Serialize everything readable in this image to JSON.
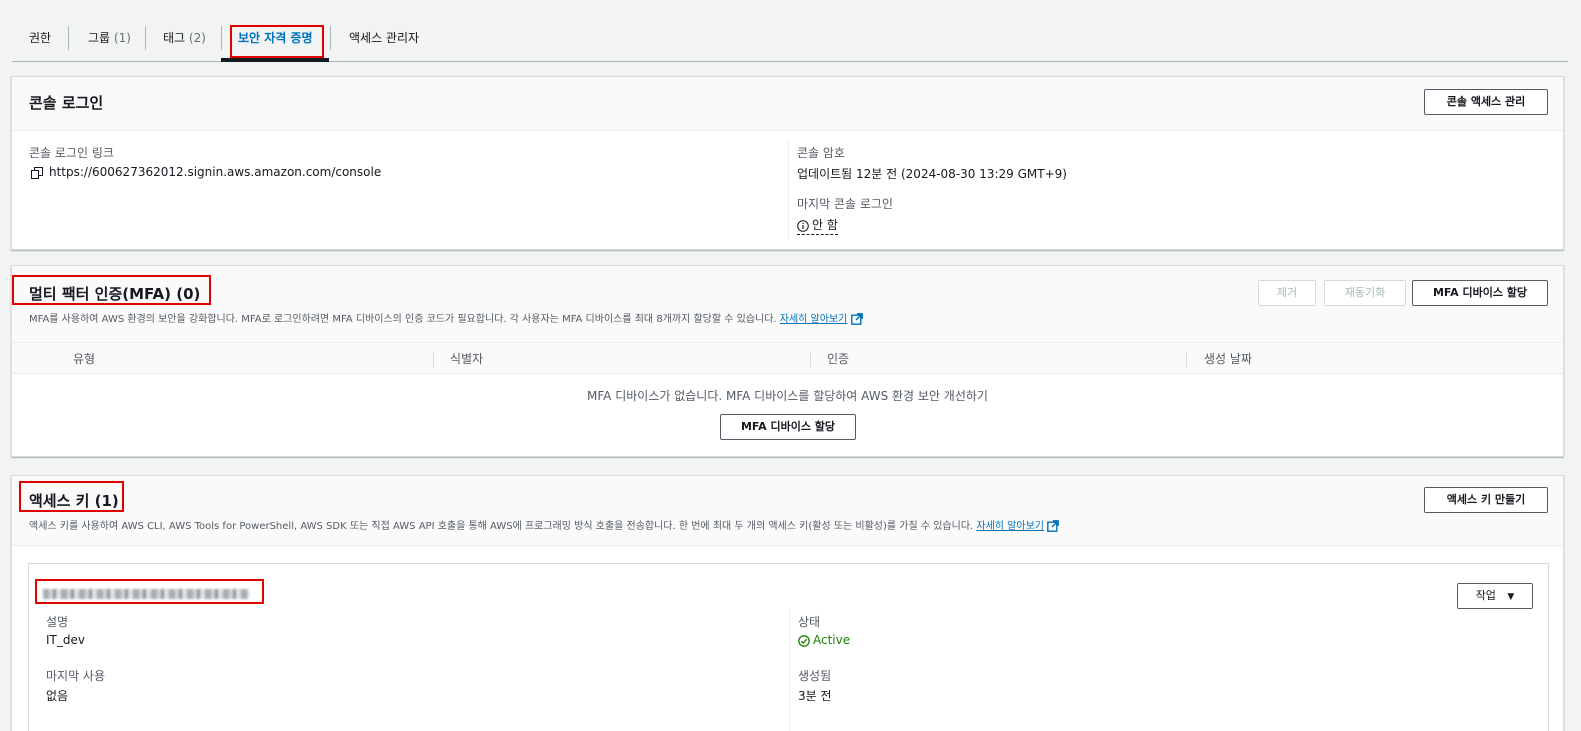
{
  "tabs": [
    {
      "label": "권한",
      "count": ""
    },
    {
      "label": "그룹",
      "count": "(1)"
    },
    {
      "label": "태그",
      "count": "(2)"
    },
    {
      "label": "보안 자격 증명",
      "count": ""
    },
    {
      "label": "액세스 관리자",
      "count": ""
    }
  ],
  "console": {
    "title": "콘솔 로그인",
    "manage_button": "콘솔 액세스 관리",
    "link_label": "콘솔 로그인 링크",
    "link_value": "https://600627362012.signin.aws.amazon.com/console",
    "password_label": "콘솔 암호",
    "password_value": "업데이트됨 12분 전 (2024-08-30 13:29 GMT+9)",
    "last_login_label": "마지막 콘솔 로그인",
    "last_login_value": "안 함"
  },
  "mfa": {
    "title": "멀티 팩터 인증(MFA) (0)",
    "description": "MFA를 사용하여 AWS 환경의 보안을 강화합니다. MFA로 로그인하려면 MFA 디바이스의 인증 코드가 필요합니다. 각 사용자는 MFA 디바이스를 최대 8개까지 할당할 수 있습니다.",
    "learn_more": "자세히 알아보기",
    "remove_button": "제거",
    "resync_button": "재동기화",
    "assign_button": "MFA 디바이스 할당",
    "columns": [
      "유형",
      "식별자",
      "인증",
      "생성 날짜"
    ],
    "empty_text": "MFA 디바이스가 없습니다. MFA 디바이스를 할당하여 AWS 환경 보안 개선하기",
    "empty_assign_button": "MFA 디바이스 할당"
  },
  "access_keys": {
    "title": "액세스 키 (1)",
    "description": "액세스 키를 사용하여 AWS CLI, AWS Tools for PowerShell, AWS SDK 또는 직접 AWS API 호출을 통해 AWS에 프로그래밍 방식 호출을 전송합니다. 한 번에 최대 두 개의 액세스 키(활성 또는 비활성)를 가질 수 있습니다.",
    "learn_more": "자세히 알아보기",
    "create_button": "액세스 키 만들기",
    "key": {
      "actions_button": "작업",
      "description_label": "설명",
      "description_value": "IT_dev",
      "status_label": "상태",
      "status_value": "Active",
      "last_used_label": "마지막 사용",
      "last_used_value": "없음",
      "created_label": "생성됨",
      "created_value": "3분 전"
    }
  },
  "colors": {
    "accent": "#0073bb",
    "highlight": "#e00000",
    "success": "#1d8102"
  }
}
